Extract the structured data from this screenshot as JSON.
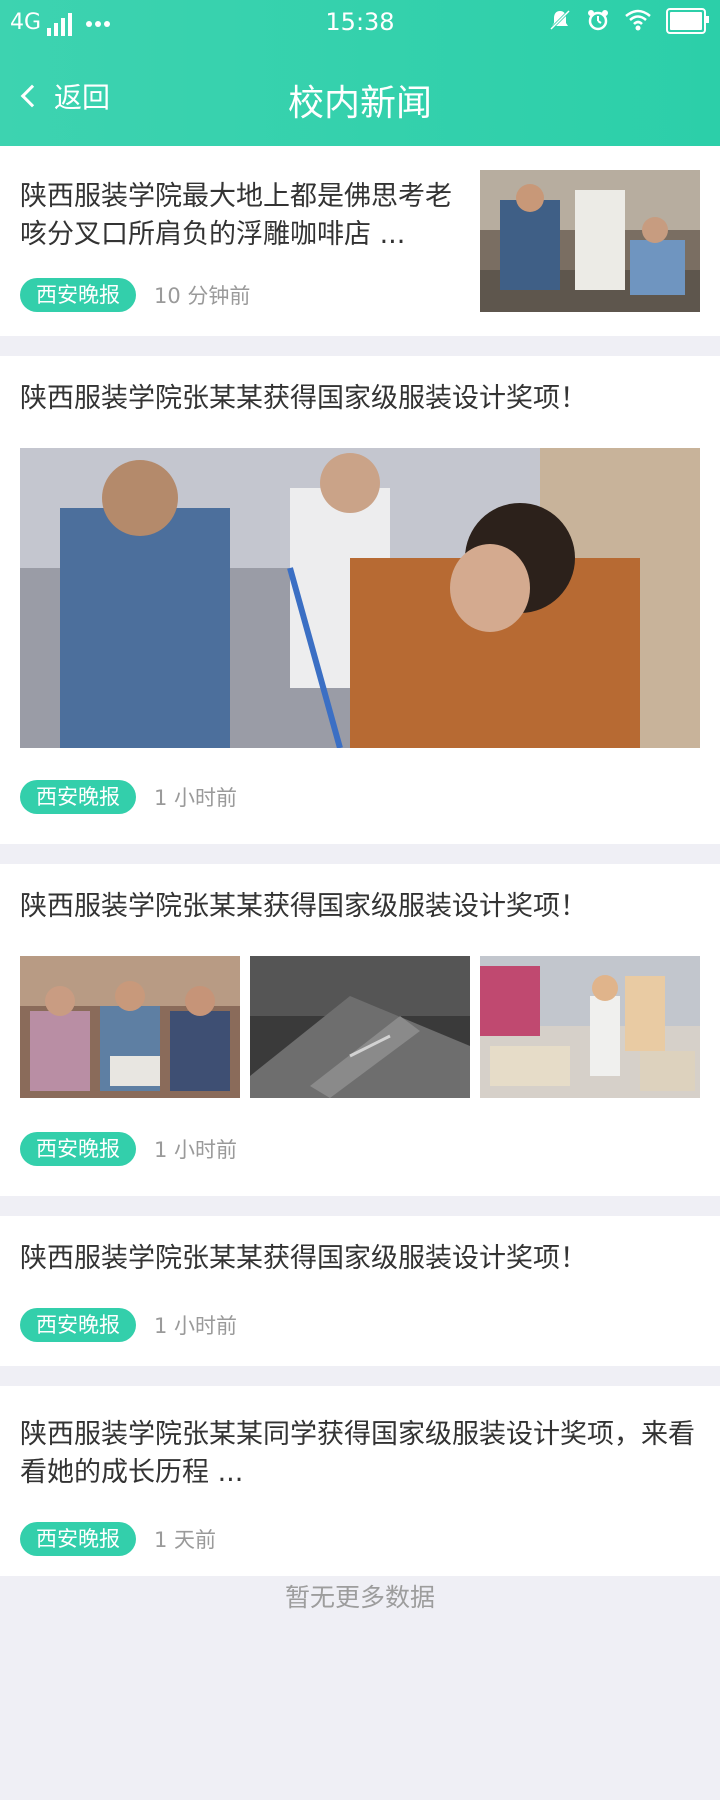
{
  "status_bar": {
    "network": "4G",
    "time": "15:38"
  },
  "nav": {
    "back_label": "返回",
    "title": "校内新闻"
  },
  "news": [
    {
      "title": "陕西服装学院最大地上都是佛思考老咳分叉口所肩负的浮雕咖啡店 ...",
      "source": "西安晚报",
      "time": "10 分钟前"
    },
    {
      "title": "陕西服装学院张某某获得国家级服装设计奖项！",
      "source": "西安晚报",
      "time": "1 小时前"
    },
    {
      "title": "陕西服装学院张某某获得国家级服装设计奖项！",
      "source": "西安晚报",
      "time": "1 小时前"
    },
    {
      "title": "陕西服装学院张某某获得国家级服装设计奖项！",
      "source": "西安晚报",
      "time": "1 小时前"
    },
    {
      "title": "陕西服装学院张某某同学获得国家级服装设计奖项，来看看她的成长历程 ...",
      "source": "西安晚报",
      "time": "1 天前"
    }
  ],
  "footer": "暂无更多数据",
  "colors": {
    "accent": "#33cfab",
    "background": "#efeff5"
  }
}
